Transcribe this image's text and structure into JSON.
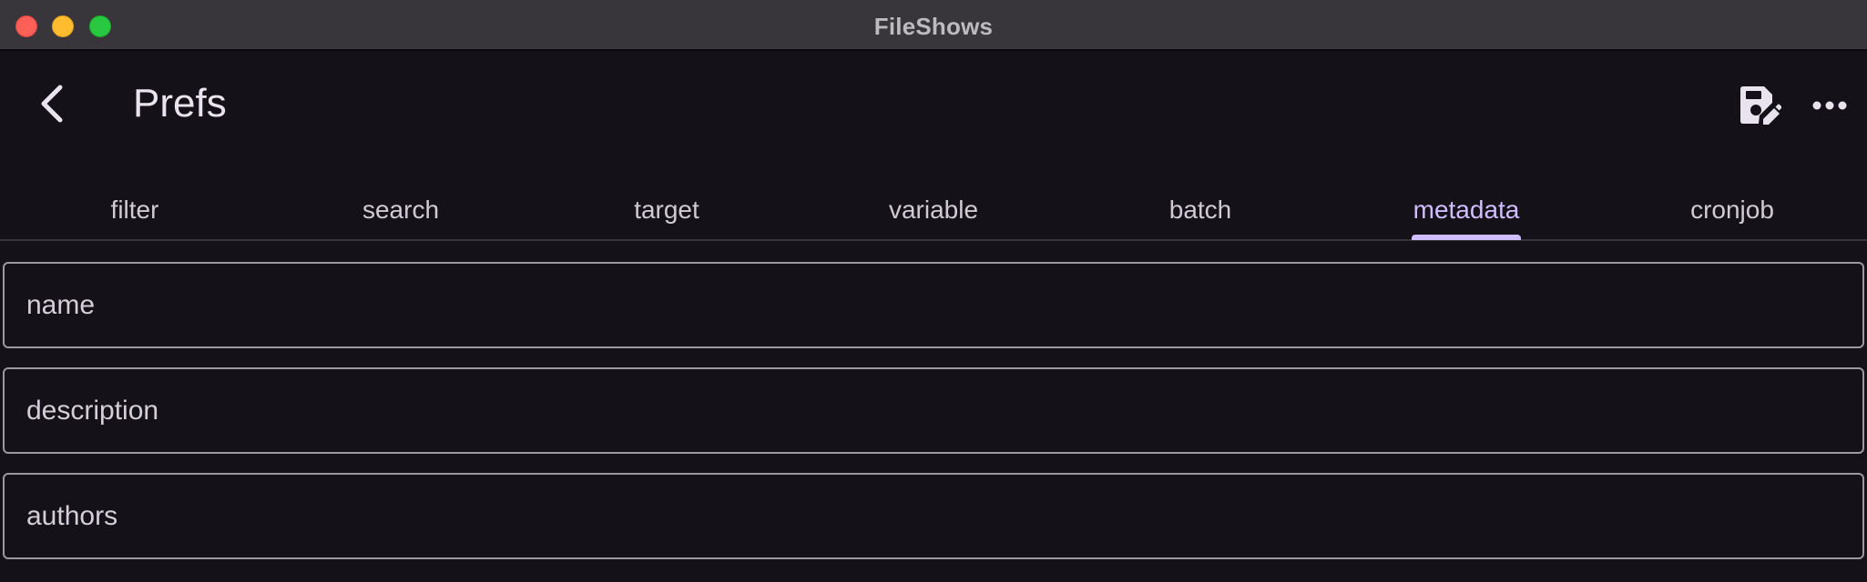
{
  "window": {
    "title": "FileShows"
  },
  "appbar": {
    "title": "Prefs",
    "back_icon": "chevron-left-icon",
    "save_icon": "save-edit-icon",
    "more_icon": "more-horizontal-icon"
  },
  "tabs": [
    {
      "label": "filter",
      "active": false
    },
    {
      "label": "search",
      "active": false
    },
    {
      "label": "target",
      "active": false
    },
    {
      "label": "variable",
      "active": false
    },
    {
      "label": "batch",
      "active": false
    },
    {
      "label": "metadata",
      "active": true
    },
    {
      "label": "cronjob",
      "active": false
    }
  ],
  "fields": [
    {
      "label": "name",
      "value": ""
    },
    {
      "label": "description",
      "value": ""
    },
    {
      "label": "authors",
      "value": ""
    }
  ],
  "colors": {
    "background": "#141218",
    "titlebar": "#38363b",
    "accent": "#cfbdfe",
    "field_border": "#9c98a1"
  }
}
